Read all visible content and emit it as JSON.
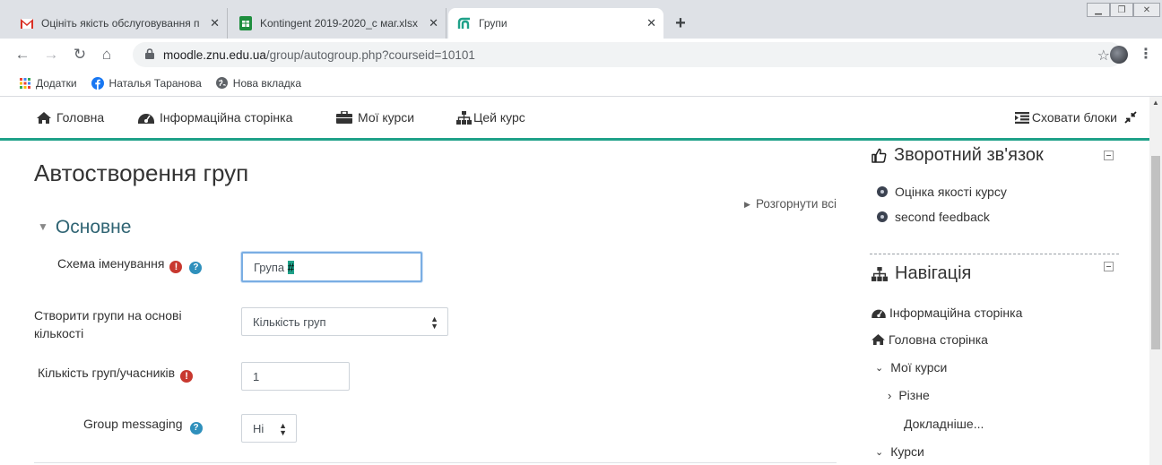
{
  "browser": {
    "tabs": [
      {
        "title": "Оцініть якість обслуговування п",
        "favicon": "gmail-icon",
        "active": false
      },
      {
        "title": "Kontingent 2019-2020_с маг.xlsx",
        "favicon": "sheets-icon",
        "active": false
      },
      {
        "title": "Групи",
        "favicon": "moodle-icon",
        "active": true
      }
    ],
    "new_tab_label": "+",
    "url_host": "moodle.znu.edu.ua",
    "url_path": "/group/autogroup.php?courseid=10101",
    "bookmarks": [
      {
        "label": "Додатки",
        "icon": "apps-grid-icon"
      },
      {
        "label": "Наталья Таранова",
        "icon": "facebook-icon"
      },
      {
        "label": "Нова вкладка",
        "icon": "globe-icon"
      }
    ]
  },
  "moodle_nav": {
    "home": "Головна",
    "dashboard": "Інформаційна сторінка",
    "my_courses": "Мої курси",
    "this_course": "Цей курс",
    "hide_blocks": "Сховати блоки"
  },
  "main": {
    "title": "Автостворення груп",
    "expand_all": "Розгорнути всі",
    "section": "Основне",
    "fields": {
      "naming_scheme": {
        "label": "Схема іменування",
        "value_prefix": "Група ",
        "value_selected": "#"
      },
      "group_by": {
        "label": "Створити групи на основі кількості",
        "value": "Кількість груп"
      },
      "count": {
        "label": "Кількість груп/учасників",
        "value": "1"
      },
      "messaging": {
        "label": "Group messaging",
        "value": "Ні"
      }
    }
  },
  "feedback_block": {
    "title": "Зворотний зв'язок",
    "items": [
      "Оцінка якості курсу",
      "second feedback"
    ]
  },
  "navigation_block": {
    "title": "Навігація",
    "dashboard": "Інформаційна сторінка",
    "site_home": "Головна сторінка",
    "my_courses": "Мої курси",
    "misc": "Різне",
    "more": "Докладніше...",
    "courses": "Курси"
  },
  "colors": {
    "accent": "#1fa189",
    "required": "#c8382f",
    "help": "#2f90bc"
  }
}
